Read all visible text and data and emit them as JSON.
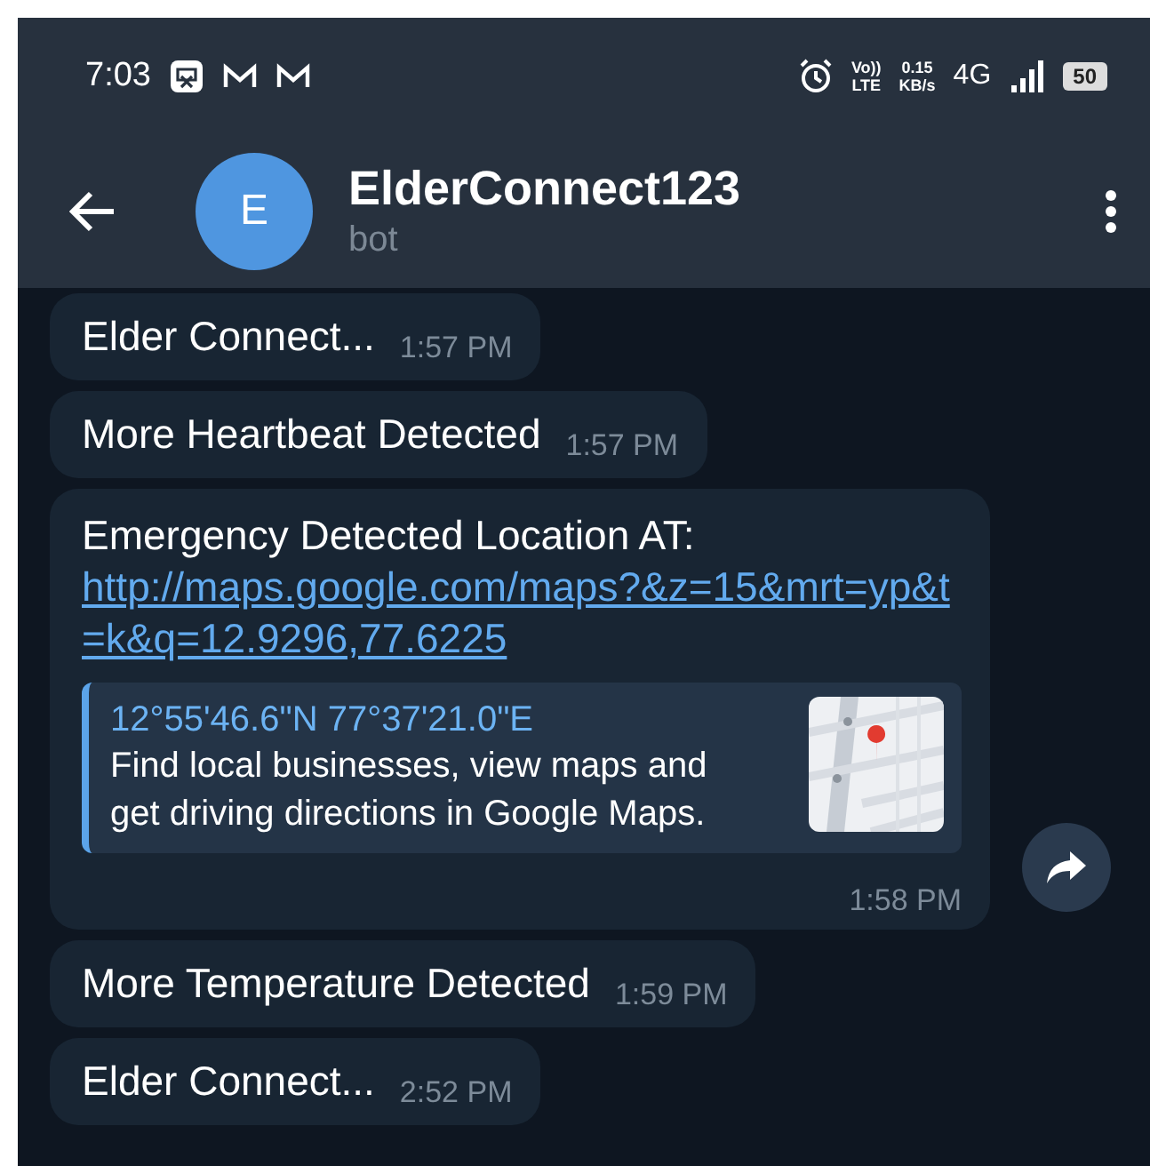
{
  "status_bar": {
    "time": "7:03",
    "volte": [
      "Vo))",
      "LTE"
    ],
    "speed": [
      "0.15",
      "KB/s"
    ],
    "network": "4G",
    "battery": "50"
  },
  "header": {
    "avatar_letter": "E",
    "title": "ElderConnect123",
    "subtitle": "bot"
  },
  "messages": [
    {
      "kind": "text",
      "text": "Elder Connect...",
      "time": "1:57 PM"
    },
    {
      "kind": "text",
      "text": "More Heartbeat Detected",
      "time": "1:57 PM"
    },
    {
      "kind": "link",
      "text": "Emergency Detected Location AT:",
      "link": "http://maps.google.com/maps?&z=15&mrt=yp&t=k&q=12.9296,77.6225",
      "preview": {
        "title": "12°55'46.6\"N 77°37'21.0\"E",
        "description": "Find local businesses, view maps and get driving directions in Google Maps."
      },
      "time": "1:58 PM",
      "forward": true
    },
    {
      "kind": "text",
      "text": "More Temperature Detected",
      "time": "1:59 PM"
    },
    {
      "kind": "text",
      "text": "Elder Connect...",
      "time": "2:52 PM"
    }
  ]
}
